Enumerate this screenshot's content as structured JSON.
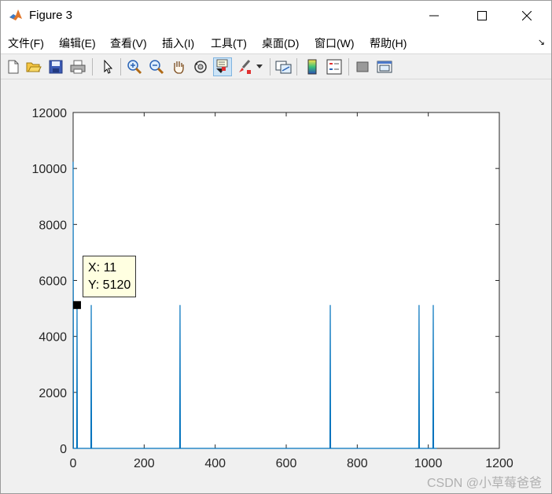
{
  "window": {
    "title": "Figure 3"
  },
  "menu": {
    "items": [
      "文件(F)",
      "编辑(E)",
      "查看(V)",
      "插入(I)",
      "工具(T)",
      "桌面(D)",
      "窗口(W)",
      "帮助(H)"
    ]
  },
  "toolbar": {
    "icons": [
      "new-figure-icon",
      "open-file-icon",
      "save-icon",
      "print-icon",
      "select-pointer-icon",
      "zoom-in-icon",
      "zoom-out-icon",
      "pan-hand-icon",
      "rotate-3d-icon",
      "data-cursor-icon",
      "brush-icon",
      "brush-dropdown-icon",
      "link-plot-icon",
      "colorbar-icon",
      "legend-icon",
      "hide-plot-tools-icon",
      "show-plot-tools-icon"
    ]
  },
  "datatip": {
    "x_label": "X: 11",
    "y_label": "Y: 5120"
  },
  "watermark": "CSDN @小草莓爸爸",
  "chart_data": {
    "type": "line",
    "title": "",
    "xlabel": "",
    "ylabel": "",
    "xlim": [
      0,
      1200
    ],
    "ylim": [
      0,
      12000
    ],
    "xticks": [
      0,
      200,
      400,
      600,
      800,
      1000,
      1200
    ],
    "yticks": [
      0,
      2000,
      4000,
      6000,
      8000,
      10000,
      12000
    ],
    "series": [
      {
        "color": "#0072bd",
        "points": [
          [
            0,
            10240
          ],
          [
            1,
            0
          ],
          [
            10,
            0
          ],
          [
            11,
            5120
          ],
          [
            12,
            0
          ],
          [
            50,
            0
          ],
          [
            51,
            5120
          ],
          [
            52,
            0
          ],
          [
            300,
            0
          ],
          [
            301,
            5120
          ],
          [
            302,
            0
          ],
          [
            723,
            0
          ],
          [
            724,
            5120
          ],
          [
            725,
            0
          ],
          [
            973,
            0
          ],
          [
            974,
            5120
          ],
          [
            975,
            0
          ],
          [
            1013,
            0
          ],
          [
            1014,
            5120
          ],
          [
            1015,
            0
          ],
          [
            1024,
            0
          ]
        ]
      }
    ],
    "marker": {
      "x": 11,
      "y": 5120
    }
  }
}
